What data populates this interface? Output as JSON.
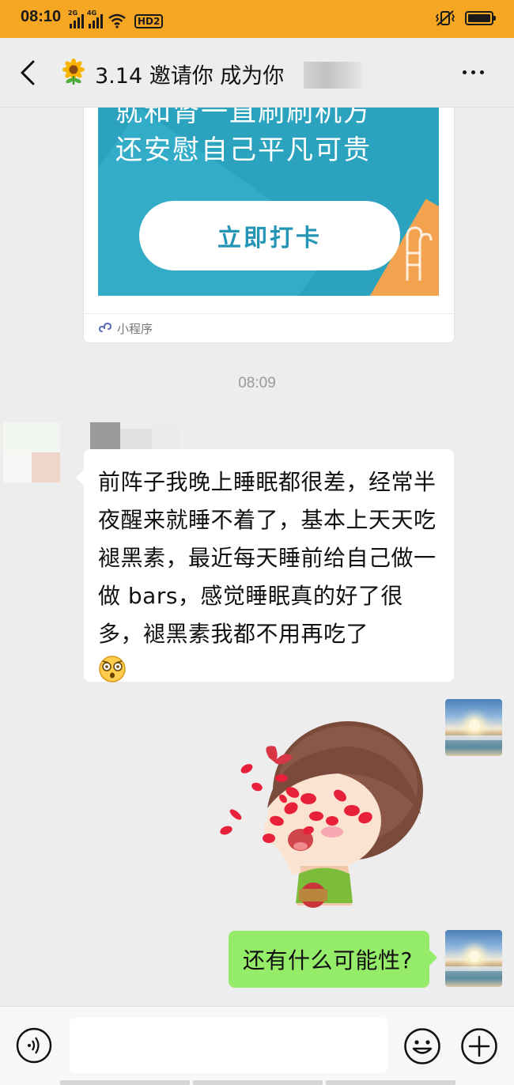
{
  "status_bar": {
    "time": "08:10",
    "network_1": "2G",
    "network_2": "4G",
    "hd_badge": "HD2",
    "icons": [
      "signal-icon",
      "signal-icon",
      "wifi-icon",
      "hd-icon",
      "vibrate-icon",
      "battery-icon"
    ]
  },
  "nav": {
    "title": "3.14 邀请你 成为你",
    "icons": [
      "back-arrow-icon",
      "sunflower-icon",
      "more-icon"
    ]
  },
  "mini_program_card": {
    "clipped_text": "就和肾一直刷刷机方",
    "slogan": "还安慰自己平凡可贵",
    "button_label": "立即打卡",
    "footer_label": "小程序",
    "footer_icon": "mini-program-icon"
  },
  "timestamp": "08:09",
  "incoming_message": {
    "text": "前阵子我晚上睡眠都很差，经常半夜醒来就睡不着了，基本上天天吃褪黑素，最近每天睡前给自己做一做 bars，感觉睡眠真的好了很多，褪黑素我都不用再吃了",
    "emoji": "shocked-face-emoji"
  },
  "sticker": {
    "name": "girl-with-rose-petals-sticker"
  },
  "outgoing_message": {
    "text": "还有什么可能性?"
  },
  "input_bar": {
    "placeholder": "",
    "icons": [
      "voice-icon",
      "emoji-icon",
      "plus-icon"
    ]
  },
  "colors": {
    "status_bar": "#f5a623",
    "background": "#ededed",
    "outgoing_bubble": "#95ec69",
    "card_blue": "#2ba3bf",
    "button_text_blue": "#2595b5"
  }
}
